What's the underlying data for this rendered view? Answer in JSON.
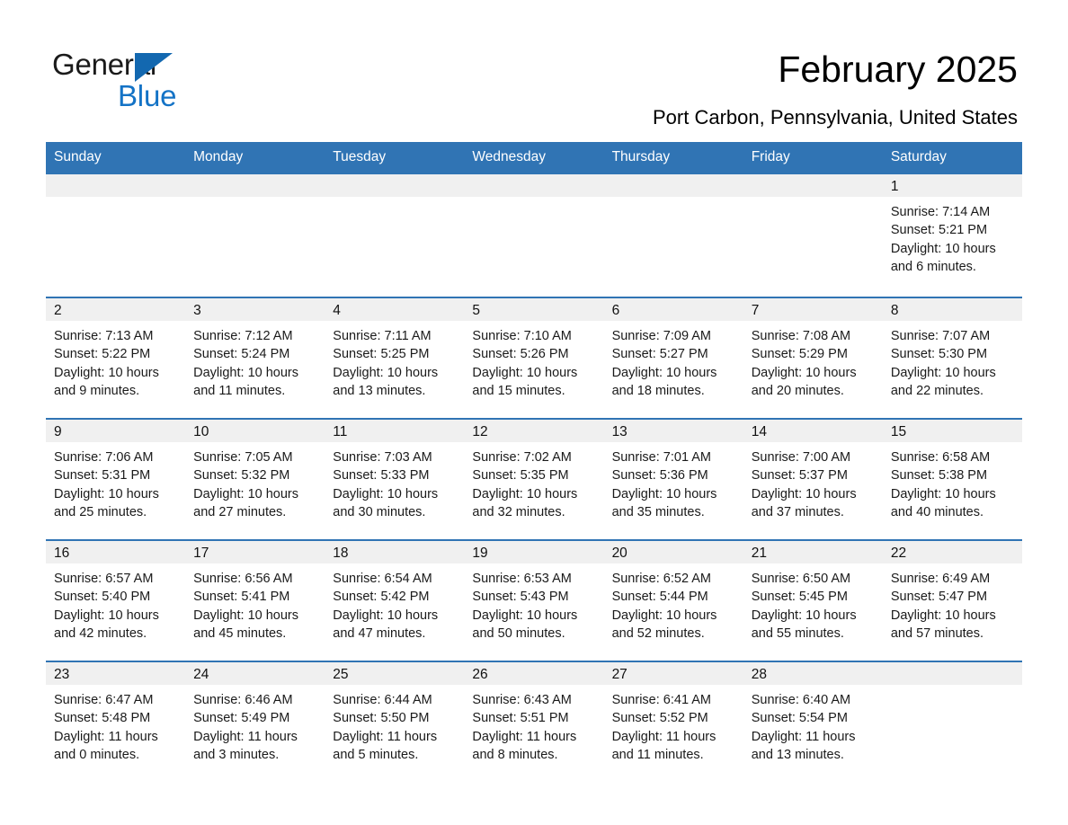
{
  "brand": {
    "name_part1": "General",
    "name_part2": "Blue",
    "triangle_color": "#1368b0",
    "blue_color": "#1473c6"
  },
  "header": {
    "title": "February 2025",
    "subtitle": "Port Carbon, Pennsylvania, United States",
    "header_bg": "#3074b4",
    "daynum_bg": "#f0f0f0"
  },
  "weekday_headers": [
    "Sunday",
    "Monday",
    "Tuesday",
    "Wednesday",
    "Thursday",
    "Friday",
    "Saturday"
  ],
  "labels": {
    "sunrise_prefix": "Sunrise:",
    "sunset_prefix": "Sunset:",
    "daylight_prefix": "Daylight:"
  },
  "weeks": [
    [
      {
        "day": "",
        "sunrise": "",
        "sunset": "",
        "daylight_line1": "",
        "daylight_line2": "",
        "empty": true
      },
      {
        "day": "",
        "sunrise": "",
        "sunset": "",
        "daylight_line1": "",
        "daylight_line2": "",
        "empty": true
      },
      {
        "day": "",
        "sunrise": "",
        "sunset": "",
        "daylight_line1": "",
        "daylight_line2": "",
        "empty": true
      },
      {
        "day": "",
        "sunrise": "",
        "sunset": "",
        "daylight_line1": "",
        "daylight_line2": "",
        "empty": true
      },
      {
        "day": "",
        "sunrise": "",
        "sunset": "",
        "daylight_line1": "",
        "daylight_line2": "",
        "empty": true
      },
      {
        "day": "",
        "sunrise": "",
        "sunset": "",
        "daylight_line1": "",
        "daylight_line2": "",
        "empty": true
      },
      {
        "day": "1",
        "sunrise": "Sunrise: 7:14 AM",
        "sunset": "Sunset: 5:21 PM",
        "daylight_line1": "Daylight: 10 hours",
        "daylight_line2": "and 6 minutes.",
        "empty": false
      }
    ],
    [
      {
        "day": "2",
        "sunrise": "Sunrise: 7:13 AM",
        "sunset": "Sunset: 5:22 PM",
        "daylight_line1": "Daylight: 10 hours",
        "daylight_line2": "and 9 minutes.",
        "empty": false
      },
      {
        "day": "3",
        "sunrise": "Sunrise: 7:12 AM",
        "sunset": "Sunset: 5:24 PM",
        "daylight_line1": "Daylight: 10 hours",
        "daylight_line2": "and 11 minutes.",
        "empty": false
      },
      {
        "day": "4",
        "sunrise": "Sunrise: 7:11 AM",
        "sunset": "Sunset: 5:25 PM",
        "daylight_line1": "Daylight: 10 hours",
        "daylight_line2": "and 13 minutes.",
        "empty": false
      },
      {
        "day": "5",
        "sunrise": "Sunrise: 7:10 AM",
        "sunset": "Sunset: 5:26 PM",
        "daylight_line1": "Daylight: 10 hours",
        "daylight_line2": "and 15 minutes.",
        "empty": false
      },
      {
        "day": "6",
        "sunrise": "Sunrise: 7:09 AM",
        "sunset": "Sunset: 5:27 PM",
        "daylight_line1": "Daylight: 10 hours",
        "daylight_line2": "and 18 minutes.",
        "empty": false
      },
      {
        "day": "7",
        "sunrise": "Sunrise: 7:08 AM",
        "sunset": "Sunset: 5:29 PM",
        "daylight_line1": "Daylight: 10 hours",
        "daylight_line2": "and 20 minutes.",
        "empty": false
      },
      {
        "day": "8",
        "sunrise": "Sunrise: 7:07 AM",
        "sunset": "Sunset: 5:30 PM",
        "daylight_line1": "Daylight: 10 hours",
        "daylight_line2": "and 22 minutes.",
        "empty": false
      }
    ],
    [
      {
        "day": "9",
        "sunrise": "Sunrise: 7:06 AM",
        "sunset": "Sunset: 5:31 PM",
        "daylight_line1": "Daylight: 10 hours",
        "daylight_line2": "and 25 minutes.",
        "empty": false
      },
      {
        "day": "10",
        "sunrise": "Sunrise: 7:05 AM",
        "sunset": "Sunset: 5:32 PM",
        "daylight_line1": "Daylight: 10 hours",
        "daylight_line2": "and 27 minutes.",
        "empty": false
      },
      {
        "day": "11",
        "sunrise": "Sunrise: 7:03 AM",
        "sunset": "Sunset: 5:33 PM",
        "daylight_line1": "Daylight: 10 hours",
        "daylight_line2": "and 30 minutes.",
        "empty": false
      },
      {
        "day": "12",
        "sunrise": "Sunrise: 7:02 AM",
        "sunset": "Sunset: 5:35 PM",
        "daylight_line1": "Daylight: 10 hours",
        "daylight_line2": "and 32 minutes.",
        "empty": false
      },
      {
        "day": "13",
        "sunrise": "Sunrise: 7:01 AM",
        "sunset": "Sunset: 5:36 PM",
        "daylight_line1": "Daylight: 10 hours",
        "daylight_line2": "and 35 minutes.",
        "empty": false
      },
      {
        "day": "14",
        "sunrise": "Sunrise: 7:00 AM",
        "sunset": "Sunset: 5:37 PM",
        "daylight_line1": "Daylight: 10 hours",
        "daylight_line2": "and 37 minutes.",
        "empty": false
      },
      {
        "day": "15",
        "sunrise": "Sunrise: 6:58 AM",
        "sunset": "Sunset: 5:38 PM",
        "daylight_line1": "Daylight: 10 hours",
        "daylight_line2": "and 40 minutes.",
        "empty": false
      }
    ],
    [
      {
        "day": "16",
        "sunrise": "Sunrise: 6:57 AM",
        "sunset": "Sunset: 5:40 PM",
        "daylight_line1": "Daylight: 10 hours",
        "daylight_line2": "and 42 minutes.",
        "empty": false
      },
      {
        "day": "17",
        "sunrise": "Sunrise: 6:56 AM",
        "sunset": "Sunset: 5:41 PM",
        "daylight_line1": "Daylight: 10 hours",
        "daylight_line2": "and 45 minutes.",
        "empty": false
      },
      {
        "day": "18",
        "sunrise": "Sunrise: 6:54 AM",
        "sunset": "Sunset: 5:42 PM",
        "daylight_line1": "Daylight: 10 hours",
        "daylight_line2": "and 47 minutes.",
        "empty": false
      },
      {
        "day": "19",
        "sunrise": "Sunrise: 6:53 AM",
        "sunset": "Sunset: 5:43 PM",
        "daylight_line1": "Daylight: 10 hours",
        "daylight_line2": "and 50 minutes.",
        "empty": false
      },
      {
        "day": "20",
        "sunrise": "Sunrise: 6:52 AM",
        "sunset": "Sunset: 5:44 PM",
        "daylight_line1": "Daylight: 10 hours",
        "daylight_line2": "and 52 minutes.",
        "empty": false
      },
      {
        "day": "21",
        "sunrise": "Sunrise: 6:50 AM",
        "sunset": "Sunset: 5:45 PM",
        "daylight_line1": "Daylight: 10 hours",
        "daylight_line2": "and 55 minutes.",
        "empty": false
      },
      {
        "day": "22",
        "sunrise": "Sunrise: 6:49 AM",
        "sunset": "Sunset: 5:47 PM",
        "daylight_line1": "Daylight: 10 hours",
        "daylight_line2": "and 57 minutes.",
        "empty": false
      }
    ],
    [
      {
        "day": "23",
        "sunrise": "Sunrise: 6:47 AM",
        "sunset": "Sunset: 5:48 PM",
        "daylight_line1": "Daylight: 11 hours",
        "daylight_line2": "and 0 minutes.",
        "empty": false
      },
      {
        "day": "24",
        "sunrise": "Sunrise: 6:46 AM",
        "sunset": "Sunset: 5:49 PM",
        "daylight_line1": "Daylight: 11 hours",
        "daylight_line2": "and 3 minutes.",
        "empty": false
      },
      {
        "day": "25",
        "sunrise": "Sunrise: 6:44 AM",
        "sunset": "Sunset: 5:50 PM",
        "daylight_line1": "Daylight: 11 hours",
        "daylight_line2": "and 5 minutes.",
        "empty": false
      },
      {
        "day": "26",
        "sunrise": "Sunrise: 6:43 AM",
        "sunset": "Sunset: 5:51 PM",
        "daylight_line1": "Daylight: 11 hours",
        "daylight_line2": "and 8 minutes.",
        "empty": false
      },
      {
        "day": "27",
        "sunrise": "Sunrise: 6:41 AM",
        "sunset": "Sunset: 5:52 PM",
        "daylight_line1": "Daylight: 11 hours",
        "daylight_line2": "and 11 minutes.",
        "empty": false
      },
      {
        "day": "28",
        "sunrise": "Sunrise: 6:40 AM",
        "sunset": "Sunset: 5:54 PM",
        "daylight_line1": "Daylight: 11 hours",
        "daylight_line2": "and 13 minutes.",
        "empty": false
      },
      {
        "day": "",
        "sunrise": "",
        "sunset": "",
        "daylight_line1": "",
        "daylight_line2": "",
        "empty": true
      }
    ]
  ]
}
